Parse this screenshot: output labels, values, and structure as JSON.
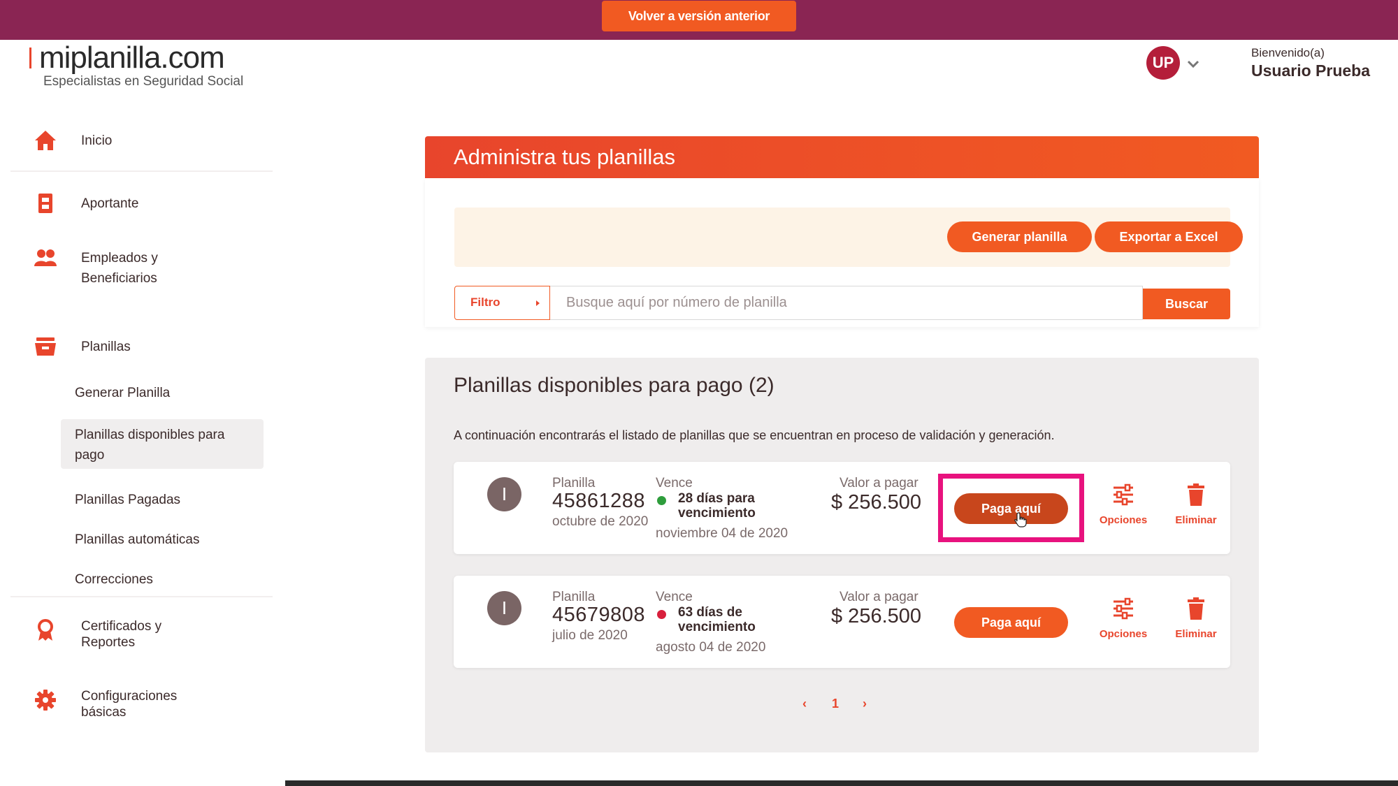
{
  "topbar": {
    "back_label": "Volver a versión anterior"
  },
  "header": {
    "logo_name": "miplanilla.com",
    "logo_tagline": "Especialistas en Seguridad Social",
    "user_initials": "UP",
    "welcome": "Bienvenido(a)",
    "user_name": "Usuario Prueba"
  },
  "sidebar": {
    "items": [
      {
        "label": "Inicio",
        "icon": "home-icon"
      },
      {
        "label": "Aportante",
        "icon": "contributor-icon"
      },
      {
        "label": "Empleados y\nBeneficiarios",
        "icon": "people-icon"
      },
      {
        "label": "Planillas",
        "icon": "tray-icon"
      },
      {
        "label": "Certificados y\nReportes",
        "icon": "ribbon-icon"
      },
      {
        "label": "Configuraciones\nbásicas",
        "icon": "gear-icon"
      }
    ],
    "sub_items": [
      "Generar Planilla",
      "Planillas disponibles para\npago",
      "Planillas Pagadas",
      "Planillas automáticas",
      "Correcciones"
    ]
  },
  "main": {
    "title": "Administra tus planillas",
    "generate_label": "Generar planilla",
    "export_label": "Exportar a Excel",
    "filter_label": "Filtro",
    "search_placeholder": "Busque aquí por número de planilla",
    "search_label": "Buscar",
    "list_title": "Planillas disponibles para pago (2)",
    "list_desc": "A continuación encontrarás el listado de planillas que se encuentran en proceso de validación y generación.",
    "rows": [
      {
        "badge": "I",
        "planilla_label": "Planilla",
        "number": "45861288",
        "period": "octubre de 2020",
        "due_label": "Vence",
        "days": "28 días para vencimiento",
        "due_date": "noviembre 04 de 2020",
        "status_color": "#2e9d3c",
        "amount_label": "Valor a pagar",
        "amount": "$ 256.500",
        "pay_label": "Paga aquí",
        "options_label": "Opciones",
        "delete_label": "Eliminar"
      },
      {
        "badge": "I",
        "planilla_label": "Planilla",
        "number": "45679808",
        "period": "julio de 2020",
        "due_label": "Vence",
        "days": "63 días de vencimiento",
        "due_date": "agosto 04 de 2020",
        "status_color": "#d81f3c",
        "amount_label": "Valor a pagar",
        "amount": "$ 256.500",
        "pay_label": "Paga aquí",
        "options_label": "Opciones",
        "delete_label": "Eliminar"
      }
    ],
    "pagination": {
      "prev": "‹",
      "page": "1",
      "next": "›"
    }
  },
  "colors": {
    "brand": "#8a2553",
    "accent": "#f15a22",
    "highlight": "#e8127e"
  }
}
